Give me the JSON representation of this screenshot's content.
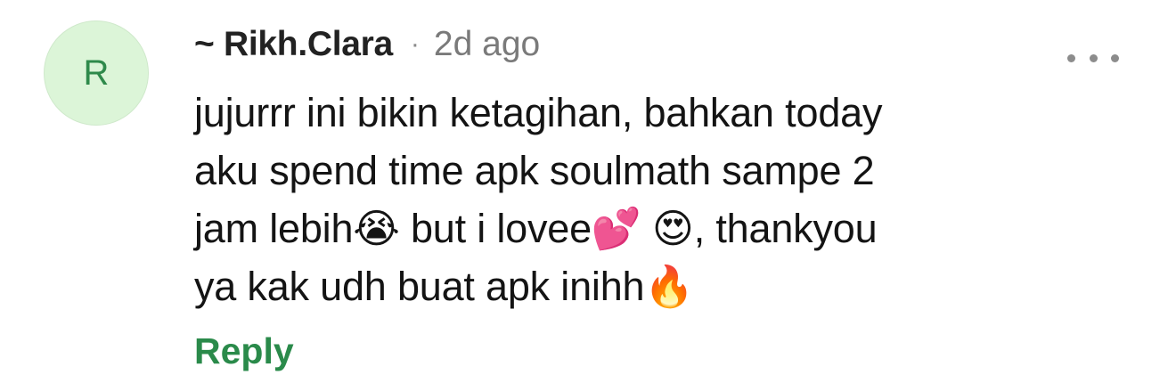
{
  "comment": {
    "avatar_initial": "R",
    "author": "~ Rikh.Clara",
    "separator": "·",
    "timestamp": "2d ago",
    "text": "jujurrr ini bikin ketagihan, bahkan today\naku spend time apk soulmath sampe 2\njam lebih😭 but i lovee💕 😍, thankyou\nya kak udh buat apk inihh🔥",
    "reply_label": "Reply",
    "more_icon": "more-horizontal-icon"
  },
  "colors": {
    "avatar_bg": "#dcf5d8",
    "avatar_text": "#2f8a4b",
    "reply": "#2a8a4a",
    "muted": "#7a7a7a"
  }
}
